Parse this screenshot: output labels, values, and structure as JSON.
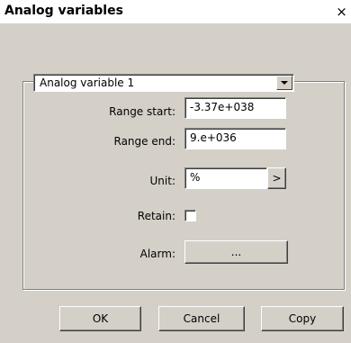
{
  "window": {
    "title": "Analog variables",
    "close_label": "×"
  },
  "variable_select": {
    "selected": "Analog variable 1"
  },
  "fields": {
    "range_start": {
      "label": "Range start:",
      "value": "-3.37e+038"
    },
    "range_end": {
      "label": "Range end:",
      "value": "9.e+036"
    },
    "unit": {
      "label": "Unit:",
      "value": "%",
      "picker_label": ">"
    },
    "retain": {
      "label": "Retain:",
      "checked": false
    },
    "alarm": {
      "label": "Alarm:",
      "button_label": "..."
    }
  },
  "buttons": {
    "ok": "OK",
    "cancel": "Cancel",
    "copy": "Copy"
  }
}
